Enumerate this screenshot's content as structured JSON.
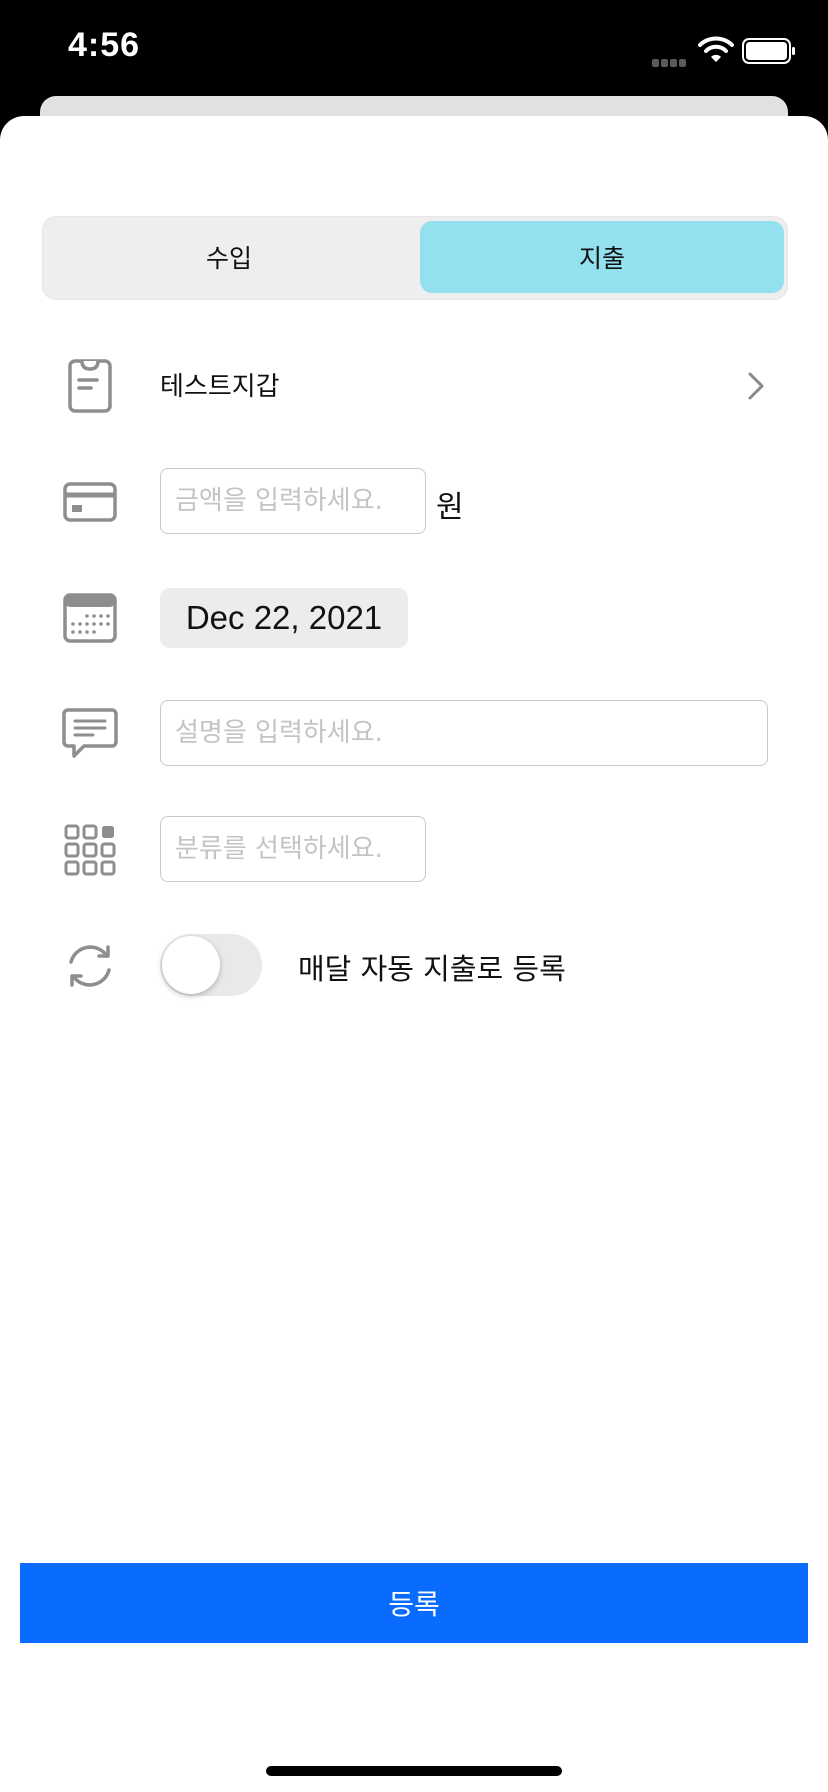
{
  "status_bar": {
    "time": "4:56"
  },
  "segment": {
    "income_label": "수입",
    "expense_label": "지출",
    "selected": "expense"
  },
  "wallet": {
    "name": "테스트지갑"
  },
  "amount": {
    "placeholder": "금액을 입력하세요.",
    "unit": "원"
  },
  "date": {
    "value": "Dec 22, 2021"
  },
  "description": {
    "placeholder": "설명을 입력하세요."
  },
  "category": {
    "placeholder": "분류를 선택하세요."
  },
  "recurring": {
    "label": "매달 자동 지출로 등록",
    "enabled": false
  },
  "submit": {
    "label": "등록"
  },
  "colors": {
    "accent": "#0a6cff",
    "segment_selected": "#93e0ef",
    "icon_gray": "#8e8e8e"
  }
}
